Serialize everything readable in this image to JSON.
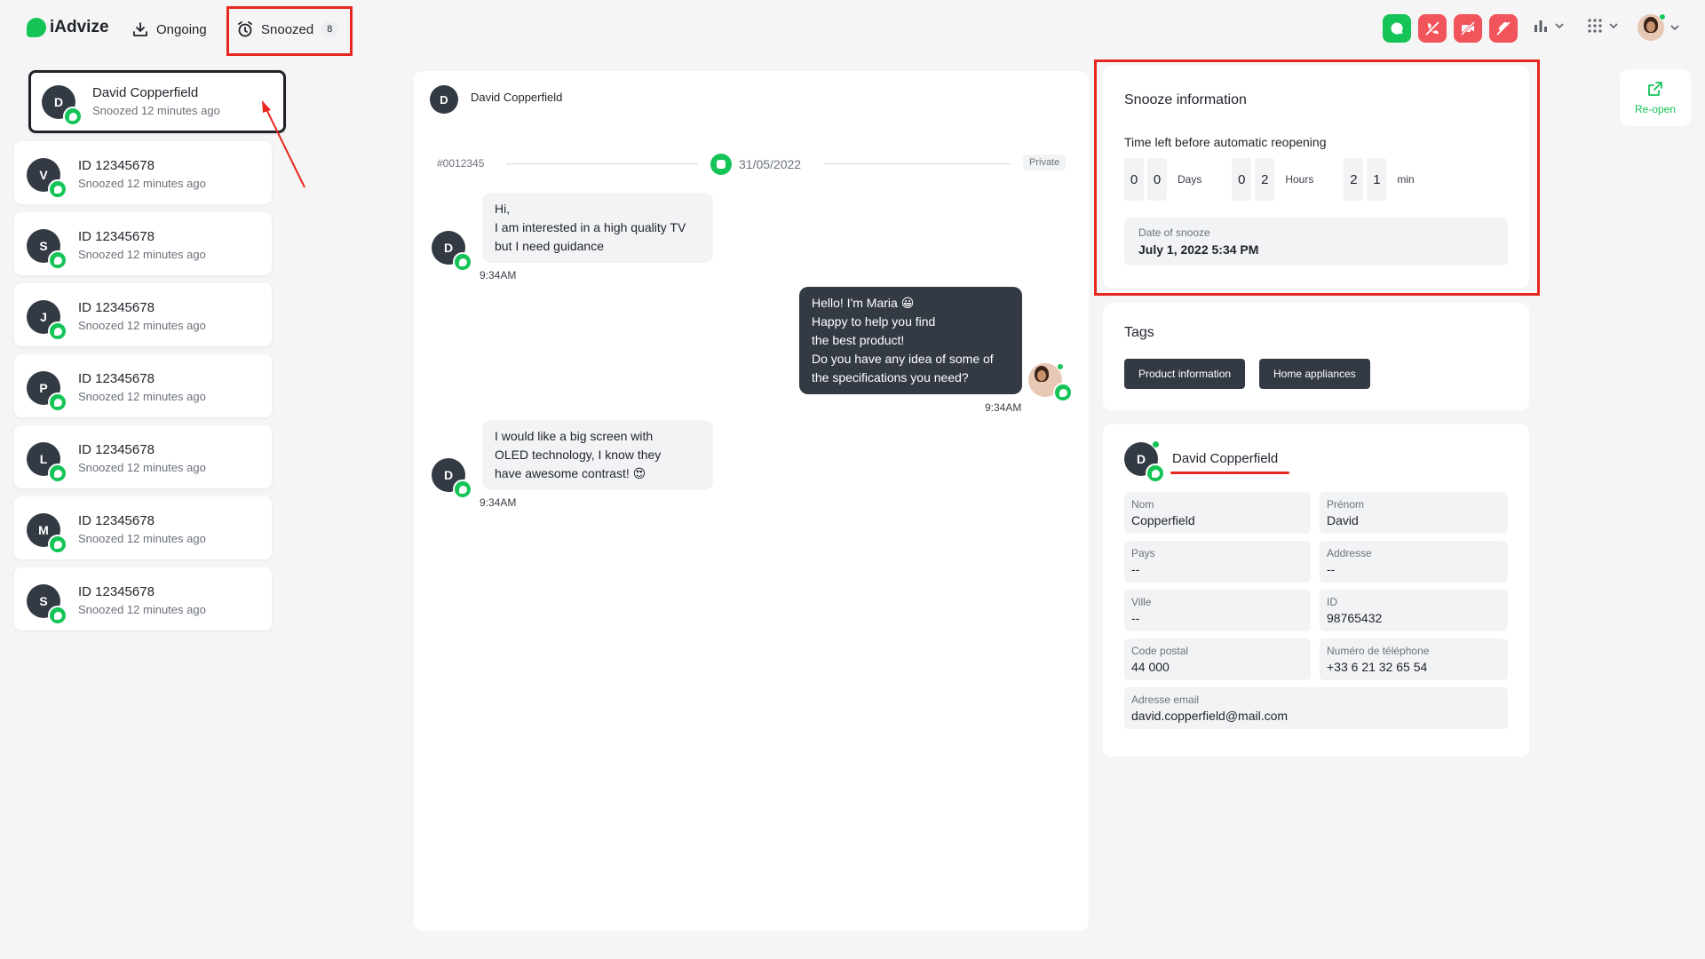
{
  "header": {
    "logo_text": "iAdvize",
    "tabs": [
      {
        "label": "Ongoing",
        "icon": "download-tray-icon"
      },
      {
        "label": "Snoozed",
        "icon": "alarm-clock-icon",
        "badge": "8"
      }
    ],
    "status_buttons": [
      "chat-icon",
      "phone-off-icon",
      "video-off-icon",
      "mic-off-icon"
    ],
    "accent_green": "#15c457",
    "status_red": "#f2545b"
  },
  "sidebar": {
    "items": [
      {
        "initial": "D",
        "name": "David Copperfield",
        "sub": "Snoozed 12 minutes ago"
      },
      {
        "initial": "V",
        "name": "ID 12345678",
        "sub": "Snoozed 12 minutes ago"
      },
      {
        "initial": "S",
        "name": "ID 12345678",
        "sub": "Snoozed 12 minutes ago"
      },
      {
        "initial": "J",
        "name": "ID 12345678",
        "sub": "Snoozed 12 minutes ago"
      },
      {
        "initial": "P",
        "name": "ID 12345678",
        "sub": "Snoozed 12 minutes ago"
      },
      {
        "initial": "L",
        "name": "ID 12345678",
        "sub": "Snoozed 12 minutes ago"
      },
      {
        "initial": "M",
        "name": "ID 12345678",
        "sub": "Snoozed 12 minutes ago"
      },
      {
        "initial": "S",
        "name": "ID 12345678",
        "sub": "Snoozed 12 minutes ago"
      }
    ]
  },
  "chat": {
    "header_initial": "D",
    "header_name": "David Copperfield",
    "conversation_id": "#0012345",
    "date": "31/05/2022",
    "private_label": "Private",
    "messages": [
      {
        "from": "visitor",
        "initial": "D",
        "lines": [
          "Hi,",
          "I am interested in a high quality TV",
          "but I need guidance"
        ],
        "time": "9:34AM"
      },
      {
        "from": "agent",
        "lines": [
          "Hello! I'm Maria 😀",
          "Happy to help you find",
          "the best product!",
          "Do you have any idea of some of",
          "the specifications you need?"
        ],
        "time": "9:34AM"
      },
      {
        "from": "visitor",
        "initial": "D",
        "lines": [
          "I would like a big screen with",
          "OLED technology, I know they",
          "have awesome contrast! 😍"
        ],
        "time": "9:34AM"
      }
    ]
  },
  "snooze": {
    "title": "Snooze information",
    "time_left_label": "Time left before automatic reopening",
    "days_digits": [
      "0",
      "0"
    ],
    "days_label": "Days",
    "hours_digits": [
      "0",
      "2"
    ],
    "hours_label": "Hours",
    "min_digits": [
      "2",
      "1"
    ],
    "min_label": "min",
    "date_label": "Date of snooze",
    "date_value": "July 1, 2022 5:34 PM"
  },
  "tags": {
    "title": "Tags",
    "items": [
      "Product information",
      "Home appliances"
    ]
  },
  "contact": {
    "initial": "D",
    "name": "David Copperfield",
    "fields": [
      {
        "label": "Nom",
        "value": "Copperfield"
      },
      {
        "label": "Prénom",
        "value": "David"
      },
      {
        "label": "Pays",
        "value": "--"
      },
      {
        "label": "Addresse",
        "value": "--"
      },
      {
        "label": "Ville",
        "value": "--"
      },
      {
        "label": "ID",
        "value": "98765432"
      },
      {
        "label": "Code postal",
        "value": "44 000"
      },
      {
        "label": "Numéro de téléphone",
        "value": "+33 6 21 32 65 54"
      },
      {
        "label": "Adresse email",
        "value": "david.copperfield@mail.com"
      }
    ]
  },
  "reopen": {
    "label": "Re-open",
    "icon": "external-link-icon"
  }
}
